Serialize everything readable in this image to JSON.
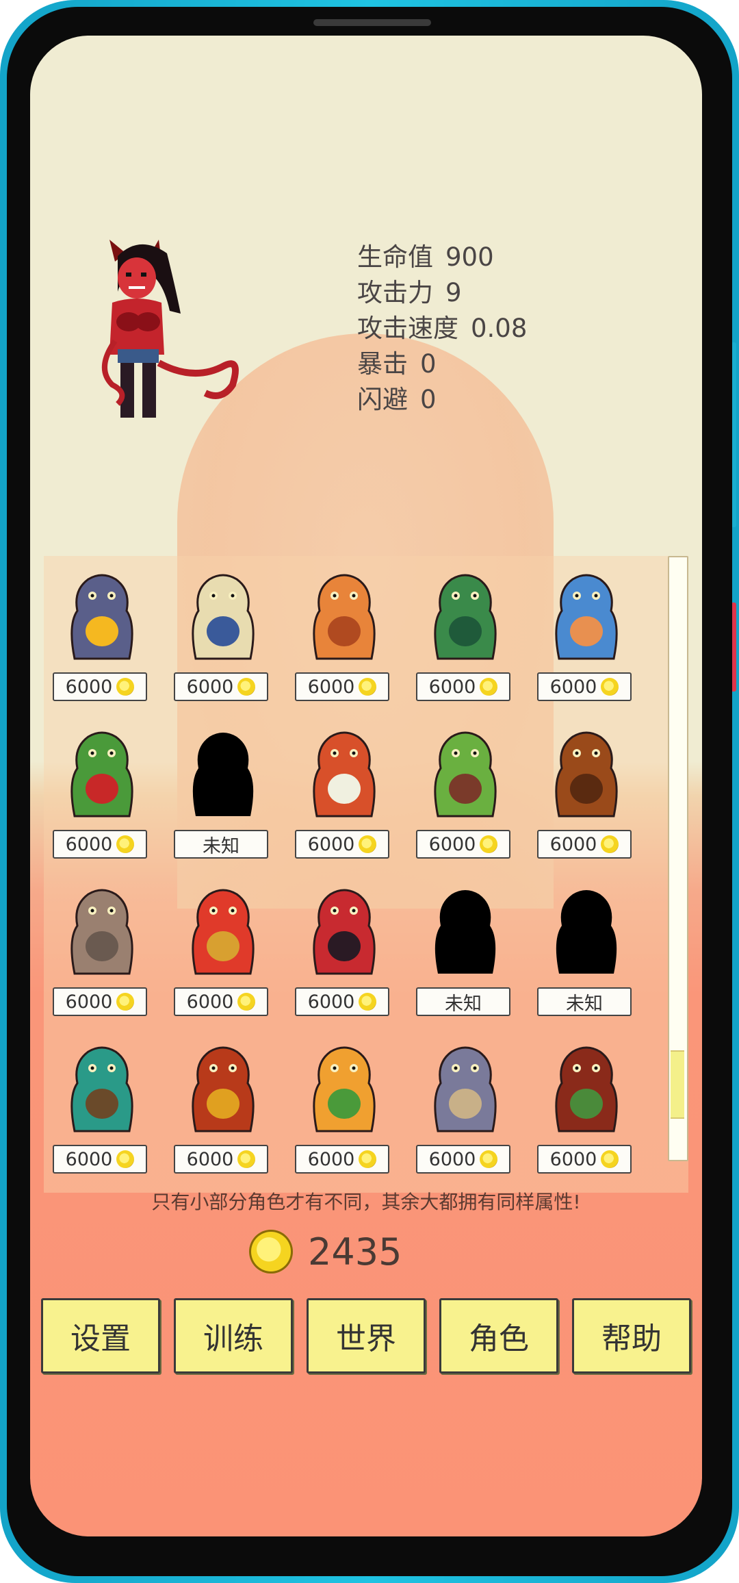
{
  "hero": {
    "icon": "succubus-hero-sprite",
    "stats": [
      {
        "label": "生命值",
        "value": "900"
      },
      {
        "label": "攻击力",
        "value": "9"
      },
      {
        "label": "攻击速度",
        "value": "0.08"
      },
      {
        "label": "暴击",
        "value": "0"
      },
      {
        "label": "闪避",
        "value": "0"
      }
    ]
  },
  "characters": [
    {
      "icon": "eye-octopus-sprite",
      "tag": "6000",
      "coin": true
    },
    {
      "icon": "skeleton-warrior-sprite",
      "tag": "6000",
      "coin": true
    },
    {
      "icon": "orange-ogre-sprite",
      "tag": "6000",
      "coin": true
    },
    {
      "icon": "green-gargoyle-sprite",
      "tag": "6000",
      "coin": true
    },
    {
      "icon": "blue-imp-sprite",
      "tag": "6000",
      "coin": true
    },
    {
      "icon": "frog-king-sprite",
      "tag": "6000",
      "coin": true
    },
    {
      "icon": "unknown-silhouette",
      "tag": "未知",
      "coin": false
    },
    {
      "icon": "red-dragon-sprite",
      "tag": "6000",
      "coin": true
    },
    {
      "icon": "goblin-boar-rider-sprite",
      "tag": "6000",
      "coin": true
    },
    {
      "icon": "minotaur-sprite",
      "tag": "6000",
      "coin": true
    },
    {
      "icon": "rock-golem-sprite",
      "tag": "6000",
      "coin": true
    },
    {
      "icon": "lizard-warrior-sprite",
      "tag": "6000",
      "coin": true
    },
    {
      "icon": "succubus-sprite",
      "tag": "6000",
      "coin": true
    },
    {
      "icon": "unknown-silhouette",
      "tag": "未知",
      "coin": false
    },
    {
      "icon": "unknown-silhouette",
      "tag": "未知",
      "coin": false
    },
    {
      "icon": "green-troll-sprite",
      "tag": "6000",
      "coin": true
    },
    {
      "icon": "mimic-chest-sprite",
      "tag": "6000",
      "coin": true
    },
    {
      "icon": "chimera-sprite",
      "tag": "6000",
      "coin": true
    },
    {
      "icon": "grey-beast-sprite",
      "tag": "6000",
      "coin": true
    },
    {
      "icon": "treant-sprite",
      "tag": "6000",
      "coin": true
    }
  ],
  "note": "只有小部分角色才有不同，其余大都拥有同样属性!",
  "gold": {
    "icon": "gold-coin-icon",
    "value": "2435"
  },
  "menu": [
    {
      "label": "设置"
    },
    {
      "label": "训练"
    },
    {
      "label": "世界"
    },
    {
      "label": "角色"
    },
    {
      "label": "帮助"
    }
  ],
  "colors": {
    "button": "#f8f28e",
    "background_top": "#f0ecd2",
    "background_bottom": "#fb9376",
    "phone_frame": "#1fc3e2"
  }
}
